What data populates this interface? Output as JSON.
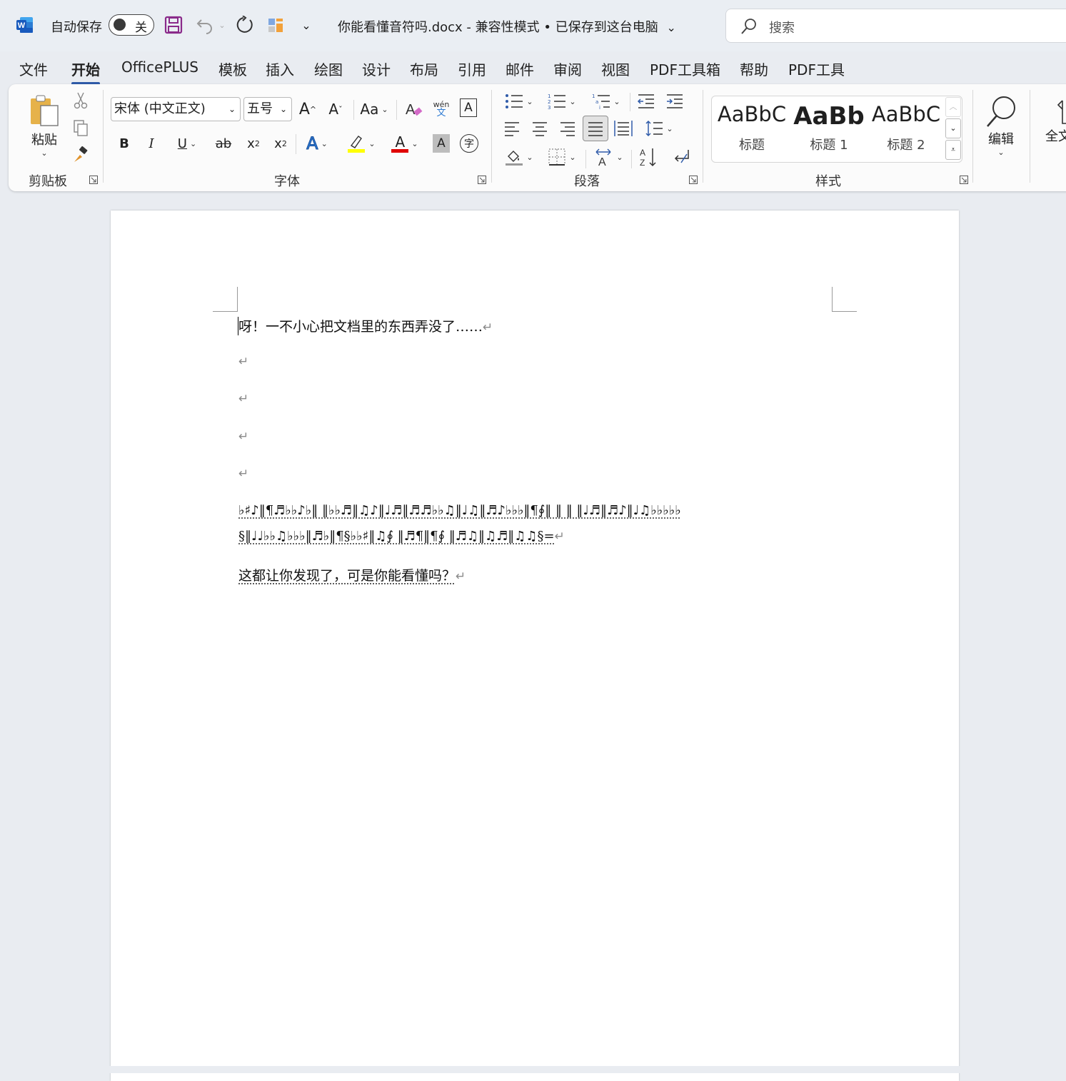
{
  "titlebar": {
    "autosave_label": "自动保存",
    "autosave_state": "关",
    "document_title": "你能看懂音符吗.docx - 兼容性模式 • 已保存到这台电脑",
    "title_chevron": "⌄",
    "search_placeholder": "搜索"
  },
  "tabs": [
    "文件",
    "开始",
    "OfficePLUS",
    "模板",
    "插入",
    "绘图",
    "设计",
    "布局",
    "引用",
    "邮件",
    "审阅",
    "视图",
    "PDF工具箱",
    "帮助",
    "PDF工具"
  ],
  "active_tab": "开始",
  "ribbon": {
    "clipboard": {
      "paste_label": "粘贴",
      "group_label": "剪贴板"
    },
    "font": {
      "font_name": "宋体 (中文正文)",
      "font_size": "五号",
      "grow": "A",
      "shrink": "A",
      "change_case": "Aa",
      "phonetic_top": "wén",
      "phonetic_bottom": "文",
      "border_char": "A",
      "bold": "B",
      "italic": "I",
      "underline": "U",
      "strike": "ab",
      "subscript": "x",
      "superscript": "x",
      "text_effect": "A",
      "font_color": "A",
      "shading_char": "A",
      "enclose_char": "字",
      "group_label": "字体",
      "highlight_color": "#ffff00",
      "font_color_value": "#e00000"
    },
    "paragraph": {
      "group_label": "段落"
    },
    "styles": {
      "items": [
        {
          "sample": "AaBbC",
          "name": "标题"
        },
        {
          "sample": "AaBb",
          "name": "标题 1"
        },
        {
          "sample": "AaBbC",
          "name": "标题 2"
        }
      ],
      "group_label": "样式"
    },
    "editing": {
      "label": "编辑"
    },
    "fulltext": {
      "label": "全文"
    }
  },
  "document": {
    "line1": "呀！一不小心把文档里的东西弄没了……",
    "music_line1": "♭♯♪‖¶♬♭♭♪♭‖ ‖♭♭♬‖♫♪‖♩♬‖♬♬♭♭♫‖♩♫‖♬♪♭♭♭‖¶∮‖ ‖ ‖ ‖♩♬‖♬♪‖♩♫♭♭♭♭♭",
    "music_line2": "§‖♩♩♭♭♫♭♭♭‖♬♭‖¶§♭♭♯‖♫∮ ‖♬¶‖¶∮ ‖♬♫‖♫♬‖♫♫§=",
    "line_last": "这都让你发现了，可是你能看懂吗？",
    "paragraph_mark": "↵"
  },
  "colors": {
    "accent": "#2f5ba9",
    "word_blue": "#185abd",
    "save_purple": "#8a2a8a"
  }
}
